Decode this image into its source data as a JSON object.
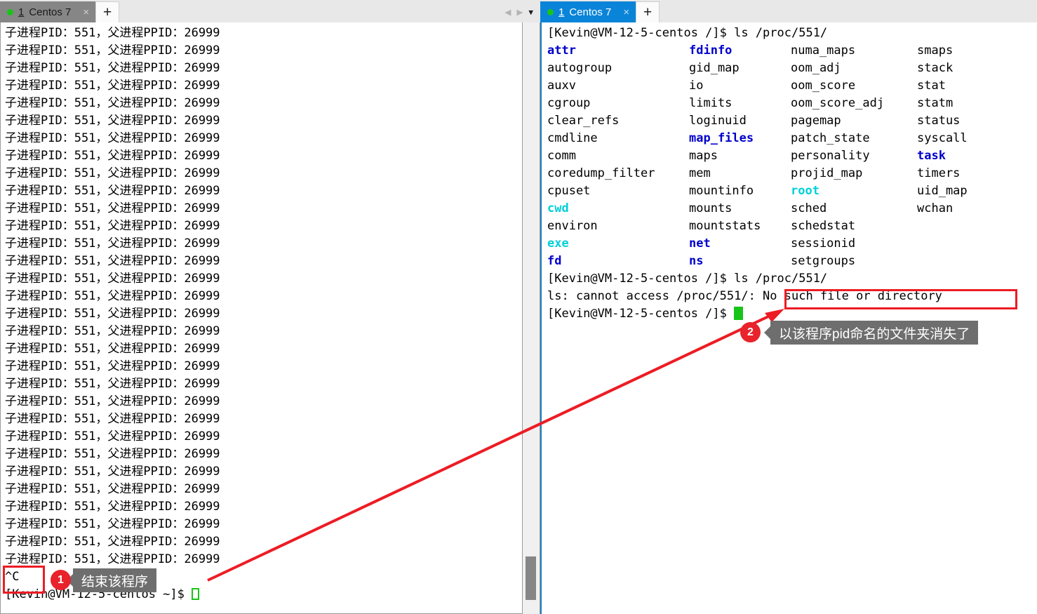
{
  "window": {
    "left_tabbar": {
      "tab": {
        "status_icon": "green-dot",
        "number": "1",
        "title": "Centos 7",
        "close": "×"
      },
      "new_tab": "+"
    },
    "right_tabbar": {
      "nav_prev": "◀",
      "nav_next": "▶",
      "nav_menu": "▼",
      "tab": {
        "status_icon": "green-dot",
        "number": "1",
        "title": "Centos 7",
        "close": "×"
      },
      "new_tab": "+"
    }
  },
  "left_terminal": {
    "repeated_line": "子进程PID：551，父进程PPID：26999",
    "repeat_count": 31,
    "interrupt_line": "^C",
    "prompt_line": "[Kevin@VM-12-5-centos ~]$ "
  },
  "right_terminal": {
    "cmd_line_1": "[Kevin@VM-12-5-centos /]$ ls /proc/551/",
    "listing_columns": [
      [
        "attr",
        "autogroup",
        "auxv",
        "cgroup",
        "clear_refs",
        "cmdline",
        "comm",
        "coredump_filter",
        "cpuset",
        "cwd",
        "environ",
        "exe",
        "fd"
      ],
      [
        "fdinfo",
        "gid_map",
        "io",
        "limits",
        "loginuid",
        "map_files",
        "maps",
        "mem",
        "mountinfo",
        "mounts",
        "mountstats",
        "net",
        "ns"
      ],
      [
        "numa_maps",
        "oom_adj",
        "oom_score",
        "oom_score_adj",
        "pagemap",
        "patch_state",
        "personality",
        "projid_map",
        "root",
        "sched",
        "schedstat",
        "sessionid",
        "setgroups"
      ],
      [
        "smaps",
        "stack",
        "stat",
        "statm",
        "status",
        "syscall",
        "task",
        "timers",
        "uid_map",
        "wchan",
        "",
        "",
        ""
      ]
    ],
    "listing_colors": [
      [
        "blue",
        "black",
        "black",
        "black",
        "black",
        "black",
        "black",
        "black",
        "black",
        "cyan",
        "black",
        "cyan",
        "blue"
      ],
      [
        "blue",
        "black",
        "black",
        "black",
        "black",
        "blue",
        "black",
        "black",
        "black",
        "black",
        "black",
        "blue",
        "blue"
      ],
      [
        "black",
        "black",
        "black",
        "black",
        "black",
        "black",
        "black",
        "black",
        "cyan",
        "black",
        "black",
        "black",
        "black"
      ],
      [
        "black",
        "black",
        "black",
        "black",
        "black",
        "black",
        "blue",
        "black",
        "black",
        "black",
        "",
        "",
        ""
      ]
    ],
    "cmd_line_2": "[Kevin@VM-12-5-centos /]$ ls /proc/551/",
    "error_prefix": "ls: cannot access /proc/551/",
    "error_highlight": "No such file or directory",
    "final_prompt": "[Kevin@VM-12-5-centos /]$ "
  },
  "annotations": {
    "badge_1": "1",
    "callout_1": "结束该程序",
    "badge_2": "2",
    "callout_2": "以该程序pid命名的文件夹消失了",
    "accent_red": "#ed1c24",
    "callout_bg": "#6e6e6e"
  }
}
